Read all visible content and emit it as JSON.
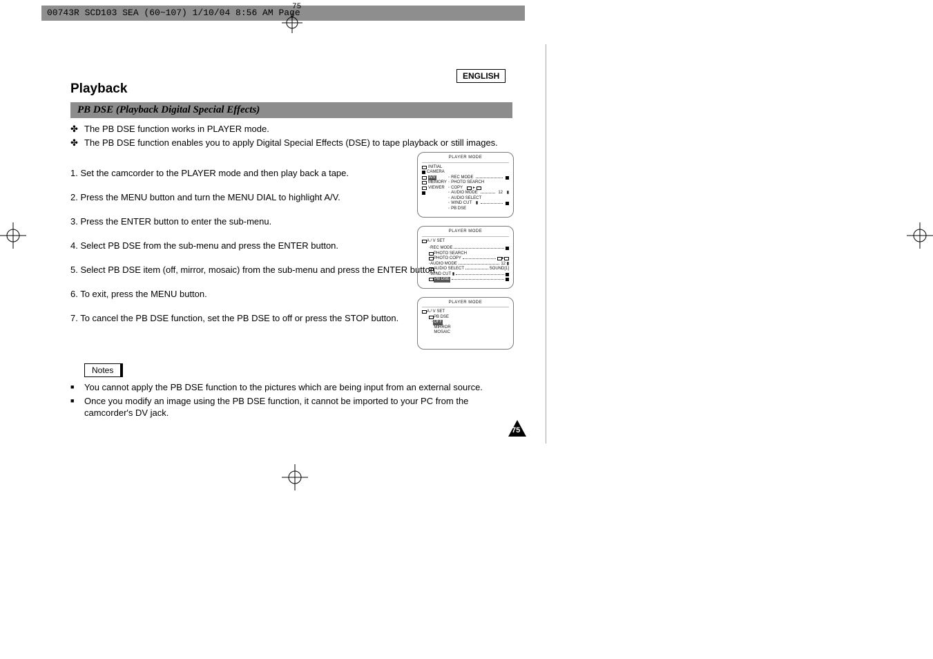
{
  "meta": {
    "file_header": "00743R SCD103 SEA (60~107)  1/10/04 8:56 AM  Page",
    "page_tick": "75",
    "language_badge": "ENGLISH",
    "page_number": "75"
  },
  "section_title": "Playback",
  "subtitle": "PB DSE (Playback Digital Special Effects)",
  "intro_bullets": [
    "The PB DSE function works in PLAYER mode.",
    "The PB DSE function enables you to apply Digital Special Effects (DSE) to tape playback or still images."
  ],
  "steps": [
    "1.  Set the camcorder to the PLAYER mode and then play back a tape.",
    "2.  Press the MENU button and turn the MENU DIAL to highlight A/V.",
    "3.  Press the ENTER button to enter the sub-menu.",
    "4.  Select PB DSE from the sub-menu and press the ENTER button.",
    "5.  Select PB DSE item (off, mirror, mosaic) from the sub-menu and press the ENTER button.",
    "6.  To exit, press the MENU button.",
    "7.  To cancel the PB DSE function, set the PB DSE to off or press the STOP button."
  ],
  "notes_label": "Notes",
  "notes": [
    "You cannot apply the PB DSE function to the pictures which are being input from an external source.",
    "Once you modify an image using the PB DSE function, it cannot be imported to your PC from the camcorder's DV jack."
  ],
  "screens": {
    "s1": {
      "title": "PLAYER  MODE",
      "left": [
        "INITIAL",
        "CAMERA",
        "A/V",
        "MEMORY",
        "VIEWER"
      ],
      "right": [
        "REC MODE",
        "PHOTO SEARCH",
        "COPY",
        "AUDIO MODE",
        "AUDIO SELECT",
        "WIND CUT",
        "PB DSE"
      ],
      "audio_mode_val": "12"
    },
    "s2": {
      "title": "PLAYER  MODE",
      "heading": "A / V SET",
      "rows": [
        {
          "label": "REC MODE",
          "trail": "square"
        },
        {
          "label": "PHOTO SEARCH"
        },
        {
          "label": "PHOTO COPY",
          "trail": "rects"
        },
        {
          "label": "AUDIO MODE",
          "val": "12"
        },
        {
          "label": "AUDIO SELECT",
          "val": "SOUND[1]"
        },
        {
          "label": "WIND CUT",
          "trail": "square"
        },
        {
          "label": "PB DSE",
          "trail": "square"
        }
      ]
    },
    "s3": {
      "title": "PLAYER  MODE",
      "heading": "A / V SET",
      "sub": "PB DSE",
      "options": [
        "OFF",
        "MIRROR",
        "MOSAIC"
      ]
    }
  }
}
